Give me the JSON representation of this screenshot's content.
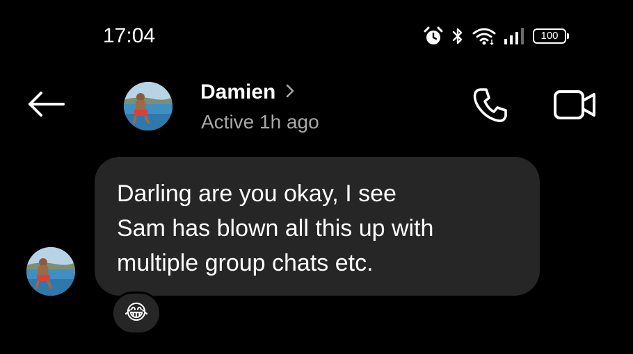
{
  "status_bar": {
    "time": "17:04",
    "battery": "100",
    "icons": [
      "alarm-icon",
      "bluetooth-icon",
      "wifi-icon",
      "signal-icon",
      "battery-icon"
    ]
  },
  "header": {
    "contact_name": "Damien",
    "status": "Active 1h ago",
    "icons": [
      "back-arrow-icon",
      "chevron-right-icon",
      "phone-icon",
      "video-camera-icon"
    ]
  },
  "messages": [
    {
      "sender": "Damien",
      "text": "Darling are you okay, I see\nSam has blown all this up with\nmultiple group chats etc.",
      "reaction": "😂"
    }
  ],
  "colors": {
    "background": "#000000",
    "bubble": "#262626",
    "text": "#ffffff",
    "secondary_text": "#a8a8a8"
  }
}
